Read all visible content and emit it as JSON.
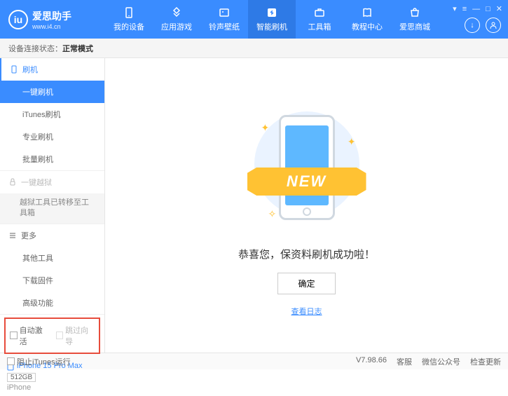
{
  "header": {
    "logo_char": "iu",
    "title": "爱思助手",
    "url": "www.i4.cn",
    "nav": [
      {
        "label": "我的设备"
      },
      {
        "label": "应用游戏"
      },
      {
        "label": "铃声壁纸"
      },
      {
        "label": "智能刷机"
      },
      {
        "label": "工具箱"
      },
      {
        "label": "教程中心"
      },
      {
        "label": "爱思商城"
      }
    ]
  },
  "status": {
    "label": "设备连接状态：",
    "value": "正常模式"
  },
  "sidebar": {
    "flash_header": "刷机",
    "flash_items": [
      "一键刷机",
      "iTunes刷机",
      "专业刷机",
      "批量刷机"
    ],
    "jailbreak_header": "一键越狱",
    "jailbreak_note": "越狱工具已转移至工具箱",
    "more_header": "更多",
    "more_items": [
      "其他工具",
      "下载固件",
      "高级功能"
    ],
    "checkbox1": "自动激活",
    "checkbox2": "跳过向导",
    "device_name": "iPhone 15 Pro Max",
    "storage": "512GB",
    "device_type": "iPhone"
  },
  "main": {
    "new_text": "NEW",
    "success": "恭喜您，保资料刷机成功啦！",
    "ok": "确定",
    "log": "查看日志"
  },
  "footer": {
    "block_itunes": "阻止iTunes运行",
    "version": "V7.98.66",
    "links": [
      "客服",
      "微信公众号",
      "检查更新"
    ]
  }
}
